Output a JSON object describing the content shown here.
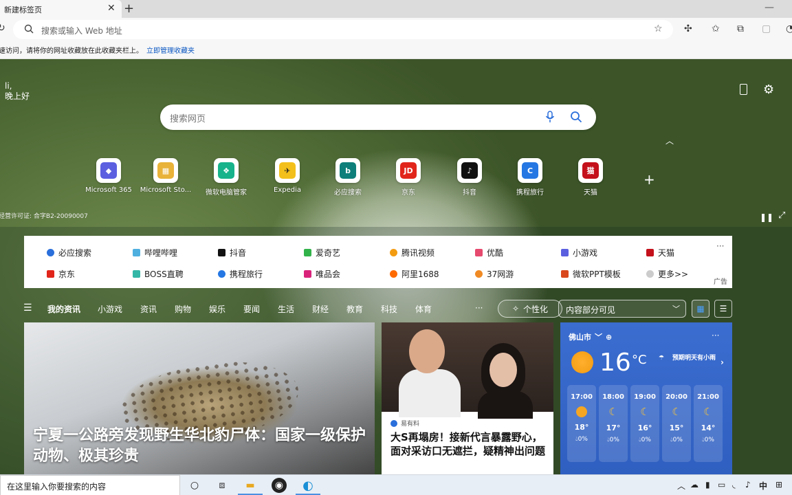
{
  "browser": {
    "tab_title": "新建标签页",
    "tab_close": "✕",
    "new_tab": "+",
    "window_minimize": "—",
    "address_placeholder": "搜索或输入 Web 地址",
    "favbar_text": "速访问，请将你的网址收藏放在此收藏夹栏上。",
    "favbar_link": "立即管理收藏夹"
  },
  "hero": {
    "greeting_line1": "li,",
    "greeting_line2": "晚上好",
    "search_placeholder": "搜索网页",
    "license": "经营许可证: 合字B2-20090007"
  },
  "quick_links": [
    {
      "label": "Microsoft 365",
      "icon": "microsoft-365-icon",
      "color": "#5b5fe0",
      "glyph": "◆"
    },
    {
      "label": "Microsoft Sto...",
      "icon": "microsoft-store-icon",
      "color": "#e9b33a",
      "glyph": "▦"
    },
    {
      "label": "微软电脑管家",
      "icon": "pc-manager-icon",
      "color": "#17b38a",
      "glyph": "❖"
    },
    {
      "label": "Expedia",
      "icon": "expedia-icon",
      "color": "#f3c01b",
      "glyph": "✈"
    },
    {
      "label": "必应搜索",
      "icon": "bing-icon",
      "color": "#0e7f7a",
      "glyph": "b"
    },
    {
      "label": "京东",
      "icon": "jd-icon",
      "color": "#e1251b",
      "glyph": "JD"
    },
    {
      "label": "抖音",
      "icon": "douyin-icon",
      "color": "#111111",
      "glyph": "♪"
    },
    {
      "label": "携程旅行",
      "icon": "ctrip-icon",
      "color": "#2577e3",
      "glyph": "C"
    },
    {
      "label": "天猫",
      "icon": "tmall-icon",
      "color": "#c4111b",
      "glyph": "猫"
    }
  ],
  "sites": {
    "row1": [
      {
        "label": "必应搜索",
        "icon": "search-icon",
        "color": "#2a6fdb"
      },
      {
        "label": "哔哩哔哩",
        "icon": "bilibili-icon",
        "color": "#4fb0e0"
      },
      {
        "label": "抖音",
        "icon": "douyin-icon",
        "color": "#111111"
      },
      {
        "label": "爱奇艺",
        "icon": "iqiyi-icon",
        "color": "#32b34a"
      },
      {
        "label": "腾讯视频",
        "icon": "tencent-video-icon",
        "color": "#f39c12"
      },
      {
        "label": "优酷",
        "icon": "youku-icon",
        "color": "#e64a6e"
      },
      {
        "label": "小游戏",
        "icon": "game-icon",
        "color": "#5a5fe0"
      },
      {
        "label": "天猫",
        "icon": "tmall-icon",
        "color": "#c4111b"
      }
    ],
    "row2": [
      {
        "label": "京东",
        "icon": "jd-icon",
        "color": "#e1251b"
      },
      {
        "label": "BOSS直聘",
        "icon": "boss-icon",
        "color": "#34b7a7"
      },
      {
        "label": "携程旅行",
        "icon": "ctrip-icon",
        "color": "#2577e3"
      },
      {
        "label": "唯品会",
        "icon": "vip-icon",
        "color": "#d9237b"
      },
      {
        "label": "阿里1688",
        "icon": "alibaba-icon",
        "color": "#ff6a00"
      },
      {
        "label": "37网游",
        "icon": "37-icon",
        "color": "#f08a24"
      },
      {
        "label": "微软PPT模板",
        "icon": "ppt-icon",
        "color": "#d9481c"
      },
      {
        "label": "更多>>",
        "icon": "more-icon",
        "color": "#888888"
      }
    ],
    "more": "···",
    "ad": "广告"
  },
  "news_nav": {
    "items": [
      "我的资讯",
      "小游戏",
      "资讯",
      "购物",
      "娱乐",
      "要闻",
      "生活",
      "财经",
      "教育",
      "科技",
      "体育",
      "···"
    ],
    "personalize": "个性化",
    "content_select": "内容部分可见"
  },
  "news": {
    "big_title": "宁夏一公路旁发现野生华北豹尸体：国家一级保护动物、极其珍贵",
    "side_source": "易有料",
    "side_title": "大S再塌房！接新代言暴露野心，面对采访口无遮拦，疑精神出问题"
  },
  "weather": {
    "city": "佛山市",
    "temp": "16",
    "unit": "°C",
    "forecast": "预期明天有小雨",
    "hours": [
      {
        "time": "17:00",
        "icon": "sun-icon",
        "temp": "18°",
        "rain": "0%"
      },
      {
        "time": "18:00",
        "icon": "moon-icon",
        "temp": "17°",
        "rain": "0%"
      },
      {
        "time": "19:00",
        "icon": "moon-icon",
        "temp": "16°",
        "rain": "0%"
      },
      {
        "time": "20:00",
        "icon": "moon-icon",
        "temp": "15°",
        "rain": "0%"
      },
      {
        "time": "21:00",
        "icon": "moon-icon",
        "temp": "14°",
        "rain": "0%"
      }
    ]
  },
  "taskbar": {
    "search_placeholder": "在这里输入你要搜索的内容",
    "ime": "中"
  }
}
